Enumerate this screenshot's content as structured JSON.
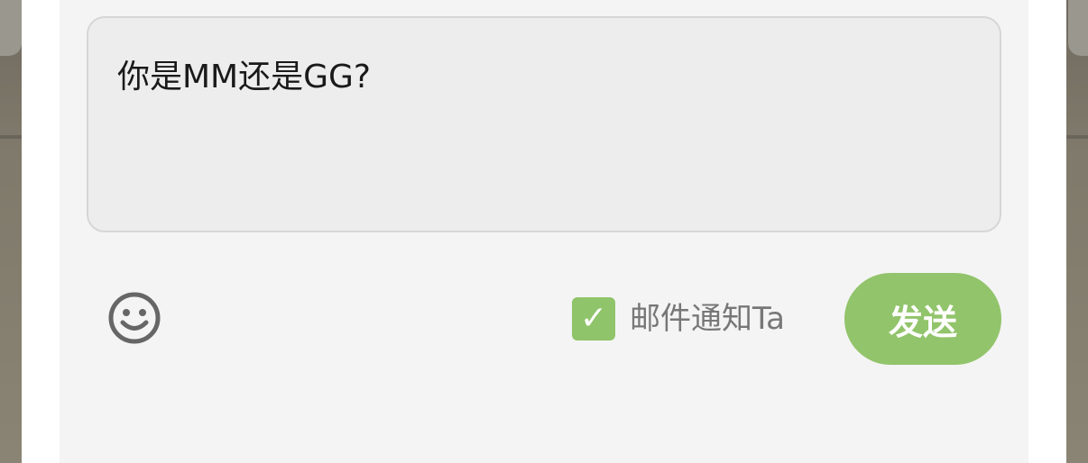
{
  "message": {
    "value": "你是MM还是GG?"
  },
  "toolbar": {
    "emoji_icon": "smiley-face-icon",
    "notify_checked": true,
    "notify_label": "邮件通知Ta",
    "check_glyph": "✓",
    "send_label": "发送"
  },
  "colors": {
    "accent": "#92c46b",
    "panel": "#f4f4f4",
    "input_bg": "#ededed",
    "backdrop": "#7d776a"
  }
}
